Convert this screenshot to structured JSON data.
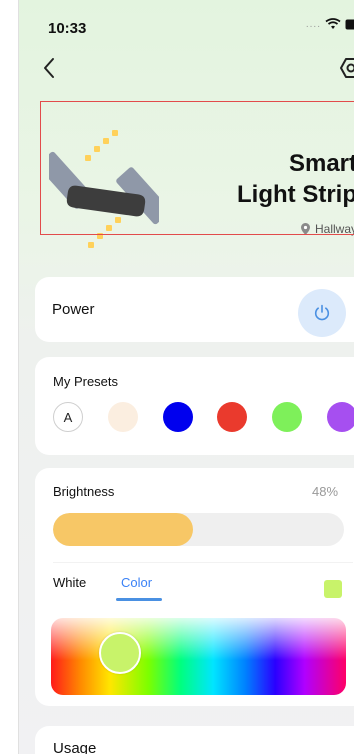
{
  "status_bar": {
    "time": "10:33",
    "signal_dots": "....",
    "icons": [
      "wifi-icon",
      "battery-icon"
    ]
  },
  "nav": {
    "back_icon": "chevron-left-icon",
    "settings_icon": "settings-hexagon-icon"
  },
  "device": {
    "name_line1": "Smart",
    "name_line2": "Light Strip",
    "location": "Hallway",
    "location_icon": "map-pin-icon"
  },
  "power": {
    "label": "Power",
    "icon": "power-icon"
  },
  "presets": {
    "label": "My Presets",
    "items": [
      {
        "label": "A",
        "color": "#ffffff"
      },
      {
        "label": "",
        "color": "#fbeee0"
      },
      {
        "label": "",
        "color": "#0000ee"
      },
      {
        "label": "",
        "color": "#ea3a2d"
      },
      {
        "label": "",
        "color": "#7ef05a"
      },
      {
        "label": "",
        "color": "#a64ff0"
      }
    ]
  },
  "brightness": {
    "label": "Brightness",
    "value_text": "48%",
    "level": 0.48,
    "fill_color": "#f7c766"
  },
  "mode_tabs": {
    "white_label": "White",
    "color_label": "Color",
    "active": "Color"
  },
  "selected_color": "#c8f36a",
  "usage": {
    "label": "Usage"
  }
}
